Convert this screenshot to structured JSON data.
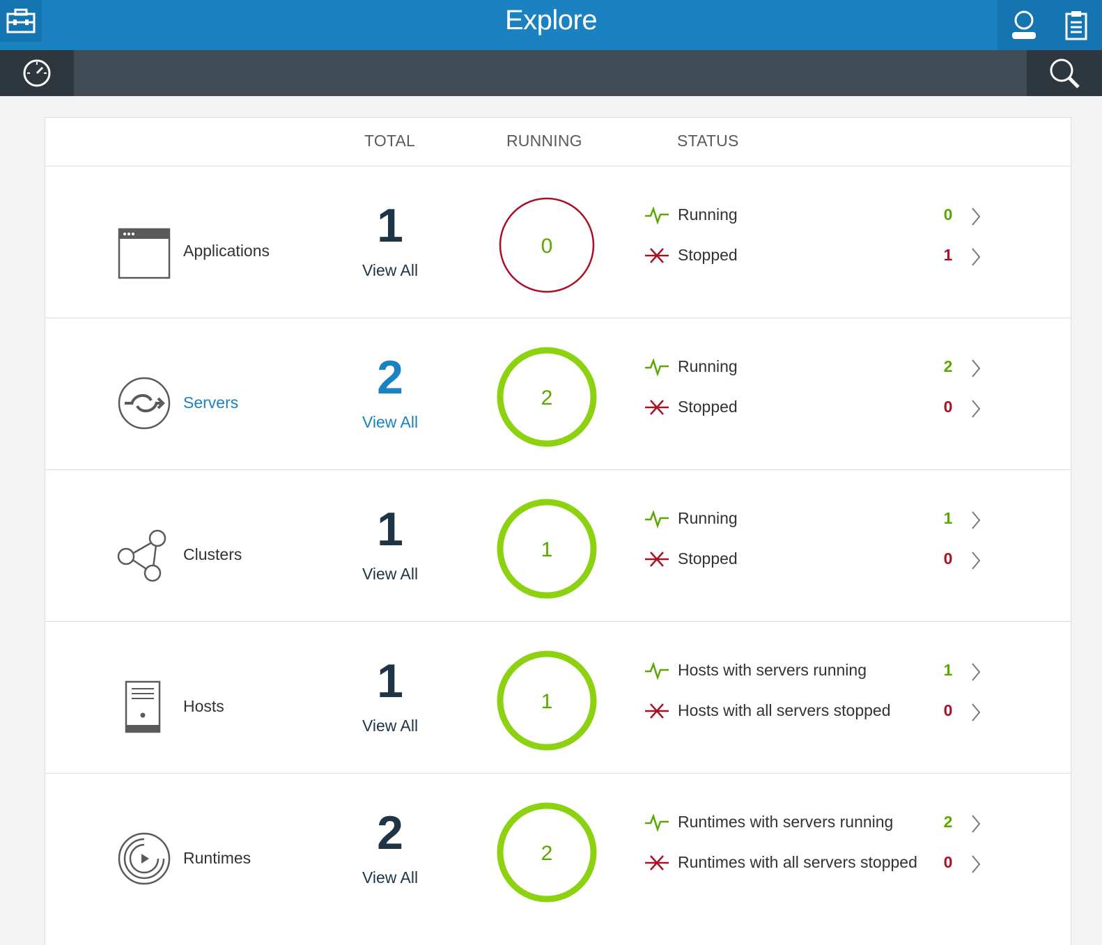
{
  "header": {
    "title": "Explore"
  },
  "columns": {
    "total": "TOTAL",
    "running": "RUNNING",
    "status": "STATUS"
  },
  "colors": {
    "brand_blue": "#1b82c1",
    "ring_green": "#8cd211",
    "ring_red": "#a91024",
    "count_green": "#5aa700",
    "count_red": "#a91024"
  },
  "rows": [
    {
      "name": "Applications",
      "icon": "application-window-icon",
      "total": "1",
      "view_all": "View All",
      "running": "0",
      "status": [
        {
          "label": "Running",
          "count": "0",
          "kind": "running"
        },
        {
          "label": "Stopped",
          "count": "1",
          "kind": "stopped"
        }
      ]
    },
    {
      "name": "Servers",
      "icon": "server-sync-icon",
      "total": "2",
      "view_all": "View All",
      "running": "2",
      "status": [
        {
          "label": "Running",
          "count": "2",
          "kind": "running"
        },
        {
          "label": "Stopped",
          "count": "0",
          "kind": "stopped"
        }
      ]
    },
    {
      "name": "Clusters",
      "icon": "cluster-nodes-icon",
      "total": "1",
      "view_all": "View All",
      "running": "1",
      "status": [
        {
          "label": "Running",
          "count": "1",
          "kind": "running"
        },
        {
          "label": "Stopped",
          "count": "0",
          "kind": "stopped"
        }
      ]
    },
    {
      "name": "Hosts",
      "icon": "host-tower-icon",
      "total": "1",
      "view_all": "View All",
      "running": "1",
      "status": [
        {
          "label": "Hosts with servers running",
          "count": "1",
          "kind": "running"
        },
        {
          "label": "Hosts with all servers stopped",
          "count": "0",
          "kind": "stopped"
        }
      ]
    },
    {
      "name": "Runtimes",
      "icon": "runtime-play-icon",
      "total": "2",
      "view_all": "View All",
      "running": "2",
      "status": [
        {
          "label": "Runtimes with servers running",
          "count": "2",
          "kind": "running"
        },
        {
          "label": "Runtimes with all servers stopped",
          "count": "0",
          "kind": "stopped"
        }
      ]
    }
  ]
}
